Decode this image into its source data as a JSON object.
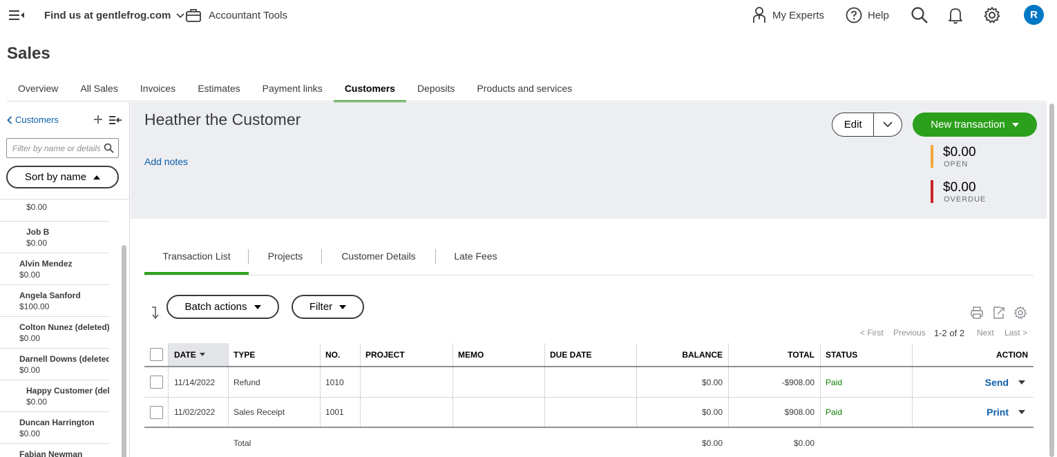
{
  "topbar": {
    "company": "Find us at gentlefrog.com",
    "accountant_tools": "Accountant Tools",
    "my_experts": "My Experts",
    "help": "Help",
    "avatar_initial": "R"
  },
  "page_title": "Sales",
  "sales_tabs": [
    {
      "label": "Overview"
    },
    {
      "label": "All Sales"
    },
    {
      "label": "Invoices"
    },
    {
      "label": "Estimates"
    },
    {
      "label": "Payment links"
    },
    {
      "label": "Customers",
      "active": true
    },
    {
      "label": "Deposits"
    },
    {
      "label": "Products and services"
    }
  ],
  "sidebar": {
    "back_label": "Customers",
    "filter_placeholder": "Filter by name or details",
    "sort_label": "Sort by name",
    "customers": [
      {
        "name": "",
        "balance": "$0.00",
        "sub": true,
        "partial": true
      },
      {
        "name": "Job B",
        "balance": "$0.00",
        "sub": true
      },
      {
        "name": "Alvin Mendez",
        "balance": "$0.00"
      },
      {
        "name": "Angela Sanford",
        "balance": "$100.00"
      },
      {
        "name": "Colton Nunez (deleted)",
        "balance": "$0.00"
      },
      {
        "name": "Darnell Downs (deleted)",
        "balance": "$0.00"
      },
      {
        "name": "Happy Customer (deleted)",
        "balance": "$0.00",
        "sub": true
      },
      {
        "name": "Duncan Harrington",
        "balance": "$0.00"
      },
      {
        "name": "Fabian Newman",
        "balance": ""
      }
    ]
  },
  "customer": {
    "name": "Heather the Customer",
    "add_notes": "Add notes",
    "edit_label": "Edit",
    "new_transaction_label": "New transaction",
    "open_amount": "$0.00",
    "open_label": "OPEN",
    "overdue_amount": "$0.00",
    "overdue_label": "OVERDUE",
    "colors": {
      "open": "#f2a73b",
      "overdue": "#c9252c",
      "accent": "#2ca01c"
    }
  },
  "content_tabs": [
    {
      "label": "Transaction List",
      "active": true
    },
    {
      "label": "Projects"
    },
    {
      "label": "Customer Details"
    },
    {
      "label": "Late Fees"
    }
  ],
  "toolbar": {
    "batch_actions": "Batch actions",
    "filter": "Filter"
  },
  "pager": {
    "first": "< First",
    "previous": "Previous",
    "range": "1-2 of 2",
    "next": "Next",
    "last": "Last >"
  },
  "table": {
    "columns": [
      "DATE",
      "TYPE",
      "NO.",
      "PROJECT",
      "MEMO",
      "DUE DATE",
      "BALANCE",
      "TOTAL",
      "STATUS",
      "ACTION"
    ],
    "rows": [
      {
        "date": "11/14/2022",
        "type": "Refund",
        "no": "1010",
        "project": "",
        "memo": "",
        "due_date": "",
        "balance": "$0.00",
        "total": "-$908.00",
        "status": "Paid",
        "action": "Send"
      },
      {
        "date": "11/02/2022",
        "type": "Sales Receipt",
        "no": "1001",
        "project": "",
        "memo": "",
        "due_date": "",
        "balance": "$0.00",
        "total": "$908.00",
        "status": "Paid",
        "action": "Print"
      }
    ],
    "footer": {
      "label": "Total",
      "balance": "$0.00",
      "total": "$0.00"
    }
  }
}
